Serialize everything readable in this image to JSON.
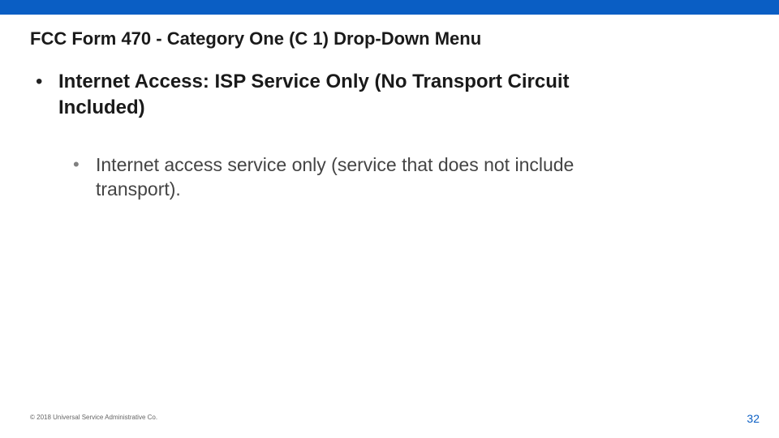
{
  "slide": {
    "title": "FCC Form 470 - Category One (C 1) Drop-Down Menu",
    "bullet1": "Internet Access: ISP Service Only (No Transport Circuit Included)",
    "sub_bullet1": "Internet access service only (service that does not include transport).",
    "footer_copyright": "© 2018 Universal Service Administrative Co.",
    "page_number": "32"
  }
}
